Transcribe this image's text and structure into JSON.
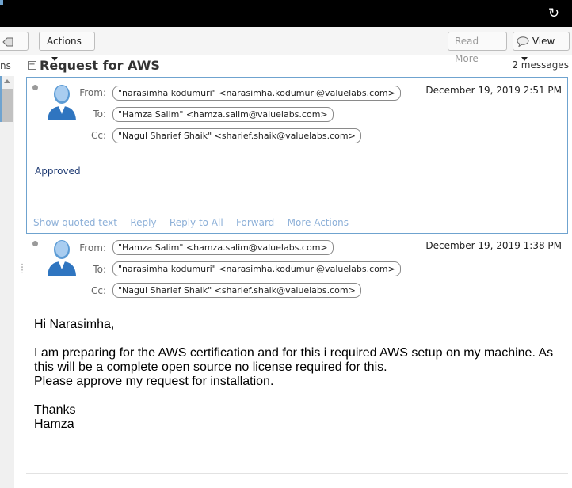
{
  "toolbar": {
    "actions_label": "Actions",
    "read_more_label": "Read More",
    "view_label": "View"
  },
  "left_pane": {
    "truncated_label": "ns"
  },
  "thread": {
    "subject": "Request for AWS",
    "message_count": "2 messages"
  },
  "messages": [
    {
      "from_label": "From:",
      "to_label": "To:",
      "cc_label": "Cc:",
      "from": "\"narasimha kodumuri\" <narasimha.kodumuri@valuelabs.com>",
      "to": "\"Hamza Salim\" <hamza.salim@valuelabs.com>",
      "cc": "\"Nagul Sharief Shaik\" <sharief.shaik@valuelabs.com>",
      "date": "December 19, 2019 2:51 PM",
      "body": "Approved",
      "links": [
        "Show quoted text",
        "Reply",
        "Reply to All",
        "Forward",
        "More Actions"
      ]
    },
    {
      "from_label": "From:",
      "to_label": "To:",
      "cc_label": "Cc:",
      "from": "\"Hamza Salim\" <hamza.salim@valuelabs.com>",
      "to": "\"narasimha kodumuri\" <narasimha.kodumuri@valuelabs.com>",
      "cc": "\"Nagul Sharief Shaik\" <sharief.shaik@valuelabs.com>",
      "date": "December 19, 2019 1:38 PM",
      "body_lines": {
        "greeting": "Hi Narasimha,",
        "line1": "I am preparing for the AWS certification and for this i required AWS setup on my machine. As",
        "line2": "this will be a complete open source no license required for this.",
        "line3": "Please approve my request  for installation.",
        "thanks": "Thanks",
        "name": "Hamza"
      }
    }
  ],
  "icons": {
    "refresh": "refresh-icon",
    "tag": "tag-icon",
    "view": "speech-bubble-icon",
    "avatar": "user-avatar-icon"
  },
  "colors": {
    "accent": "#6fa3cf",
    "link": "#8db0d8",
    "body_text": "#1f3b73"
  }
}
